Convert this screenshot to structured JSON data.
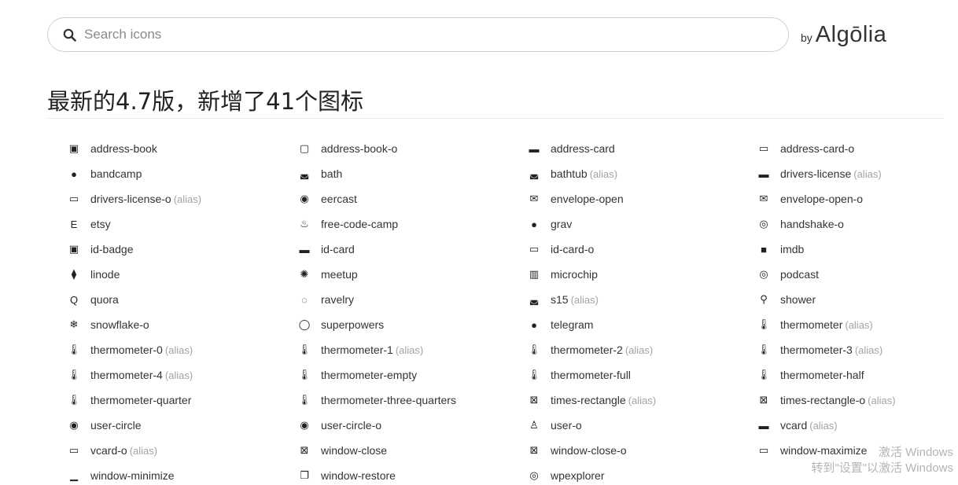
{
  "search": {
    "placeholder": "Search icons"
  },
  "brand": {
    "by": "by",
    "name": "Algōlia"
  },
  "page": {
    "title": "最新的4.7版，新增了41个图标"
  },
  "icons": [
    {
      "name": "address-book",
      "alias": "",
      "icon": "address-book-icon",
      "glyph": "▣"
    },
    {
      "name": "address-book-o",
      "alias": "",
      "icon": "address-book-o-icon",
      "glyph": "▢"
    },
    {
      "name": "address-card",
      "alias": "",
      "icon": "address-card-icon",
      "glyph": "▬"
    },
    {
      "name": "address-card-o",
      "alias": "",
      "icon": "address-card-o-icon",
      "glyph": "▭"
    },
    {
      "name": "bandcamp",
      "alias": "",
      "icon": "bandcamp-icon",
      "glyph": "●"
    },
    {
      "name": "bath",
      "alias": "",
      "icon": "bath-icon",
      "glyph": "◛"
    },
    {
      "name": "bathtub",
      "alias": "(alias)",
      "icon": "bathtub-icon",
      "glyph": "◛"
    },
    {
      "name": "drivers-license",
      "alias": "(alias)",
      "icon": "drivers-license-icon",
      "glyph": "▬"
    },
    {
      "name": "drivers-license-o",
      "alias": "(alias)",
      "icon": "drivers-license-o-icon",
      "glyph": "▭"
    },
    {
      "name": "eercast",
      "alias": "",
      "icon": "eercast-icon",
      "glyph": "◉"
    },
    {
      "name": "envelope-open",
      "alias": "",
      "icon": "envelope-open-icon",
      "glyph": "✉"
    },
    {
      "name": "envelope-open-o",
      "alias": "",
      "icon": "envelope-open-o-icon",
      "glyph": "✉"
    },
    {
      "name": "etsy",
      "alias": "",
      "icon": "etsy-icon",
      "glyph": "E"
    },
    {
      "name": "free-code-camp",
      "alias": "",
      "icon": "free-code-camp-icon",
      "glyph": "♨"
    },
    {
      "name": "grav",
      "alias": "",
      "icon": "grav-icon",
      "glyph": "●"
    },
    {
      "name": "handshake-o",
      "alias": "",
      "icon": "handshake-o-icon",
      "glyph": "◎"
    },
    {
      "name": "id-badge",
      "alias": "",
      "icon": "id-badge-icon",
      "glyph": "▣"
    },
    {
      "name": "id-card",
      "alias": "",
      "icon": "id-card-icon",
      "glyph": "▬"
    },
    {
      "name": "id-card-o",
      "alias": "",
      "icon": "id-card-o-icon",
      "glyph": "▭"
    },
    {
      "name": "imdb",
      "alias": "",
      "icon": "imdb-icon",
      "glyph": "■"
    },
    {
      "name": "linode",
      "alias": "",
      "icon": "linode-icon",
      "glyph": "⧫"
    },
    {
      "name": "meetup",
      "alias": "",
      "icon": "meetup-icon",
      "glyph": "✺"
    },
    {
      "name": "microchip",
      "alias": "",
      "icon": "microchip-icon",
      "glyph": "▥"
    },
    {
      "name": "podcast",
      "alias": "",
      "icon": "podcast-icon",
      "glyph": "◎"
    },
    {
      "name": "quora",
      "alias": "",
      "icon": "quora-icon",
      "glyph": "Q"
    },
    {
      "name": "ravelry",
      "alias": "",
      "icon": "ravelry-icon",
      "glyph": "◌"
    },
    {
      "name": "s15",
      "alias": "(alias)",
      "icon": "s15-icon",
      "glyph": "◛"
    },
    {
      "name": "shower",
      "alias": "",
      "icon": "shower-icon",
      "glyph": "⚲"
    },
    {
      "name": "snowflake-o",
      "alias": "",
      "icon": "snowflake-o-icon",
      "glyph": "❄"
    },
    {
      "name": "superpowers",
      "alias": "",
      "icon": "superpowers-icon",
      "glyph": "◯"
    },
    {
      "name": "telegram",
      "alias": "",
      "icon": "telegram-icon",
      "glyph": "●"
    },
    {
      "name": "thermometer",
      "alias": "(alias)",
      "icon": "thermometer-icon",
      "glyph": "🌡"
    },
    {
      "name": "thermometer-0",
      "alias": "(alias)",
      "icon": "thermometer-0-icon",
      "glyph": "🌡"
    },
    {
      "name": "thermometer-1",
      "alias": "(alias)",
      "icon": "thermometer-1-icon",
      "glyph": "🌡"
    },
    {
      "name": "thermometer-2",
      "alias": "(alias)",
      "icon": "thermometer-2-icon",
      "glyph": "🌡"
    },
    {
      "name": "thermometer-3",
      "alias": "(alias)",
      "icon": "thermometer-3-icon",
      "glyph": "🌡"
    },
    {
      "name": "thermometer-4",
      "alias": "(alias)",
      "icon": "thermometer-4-icon",
      "glyph": "🌡"
    },
    {
      "name": "thermometer-empty",
      "alias": "",
      "icon": "thermometer-empty-icon",
      "glyph": "🌡"
    },
    {
      "name": "thermometer-full",
      "alias": "",
      "icon": "thermometer-full-icon",
      "glyph": "🌡"
    },
    {
      "name": "thermometer-half",
      "alias": "",
      "icon": "thermometer-half-icon",
      "glyph": "🌡"
    },
    {
      "name": "thermometer-quarter",
      "alias": "",
      "icon": "thermometer-quarter-icon",
      "glyph": "🌡"
    },
    {
      "name": "thermometer-three-quarters",
      "alias": "",
      "icon": "thermometer-three-quarters-icon",
      "glyph": "🌡"
    },
    {
      "name": "times-rectangle",
      "alias": "(alias)",
      "icon": "times-rectangle-icon",
      "glyph": "⊠"
    },
    {
      "name": "times-rectangle-o",
      "alias": "(alias)",
      "icon": "times-rectangle-o-icon",
      "glyph": "⊠"
    },
    {
      "name": "user-circle",
      "alias": "",
      "icon": "user-circle-icon",
      "glyph": "◉"
    },
    {
      "name": "user-circle-o",
      "alias": "",
      "icon": "user-circle-o-icon",
      "glyph": "◉"
    },
    {
      "name": "user-o",
      "alias": "",
      "icon": "user-o-icon",
      "glyph": "♙"
    },
    {
      "name": "vcard",
      "alias": "(alias)",
      "icon": "vcard-icon",
      "glyph": "▬"
    },
    {
      "name": "vcard-o",
      "alias": "(alias)",
      "icon": "vcard-o-icon",
      "glyph": "▭"
    },
    {
      "name": "window-close",
      "alias": "",
      "icon": "window-close-icon",
      "glyph": "⊠"
    },
    {
      "name": "window-close-o",
      "alias": "",
      "icon": "window-close-o-icon",
      "glyph": "⊠"
    },
    {
      "name": "window-maximize",
      "alias": "",
      "icon": "window-maximize-icon",
      "glyph": "▭"
    },
    {
      "name": "window-minimize",
      "alias": "",
      "icon": "window-minimize-icon",
      "glyph": "▁"
    },
    {
      "name": "window-restore",
      "alias": "",
      "icon": "window-restore-icon",
      "glyph": "❐"
    },
    {
      "name": "wpexplorer",
      "alias": "",
      "icon": "wpexplorer-icon",
      "glyph": "◎"
    }
  ],
  "watermark": {
    "line1": "激活 Windows",
    "line2": "转到\"设置\"以激活 Windows"
  }
}
